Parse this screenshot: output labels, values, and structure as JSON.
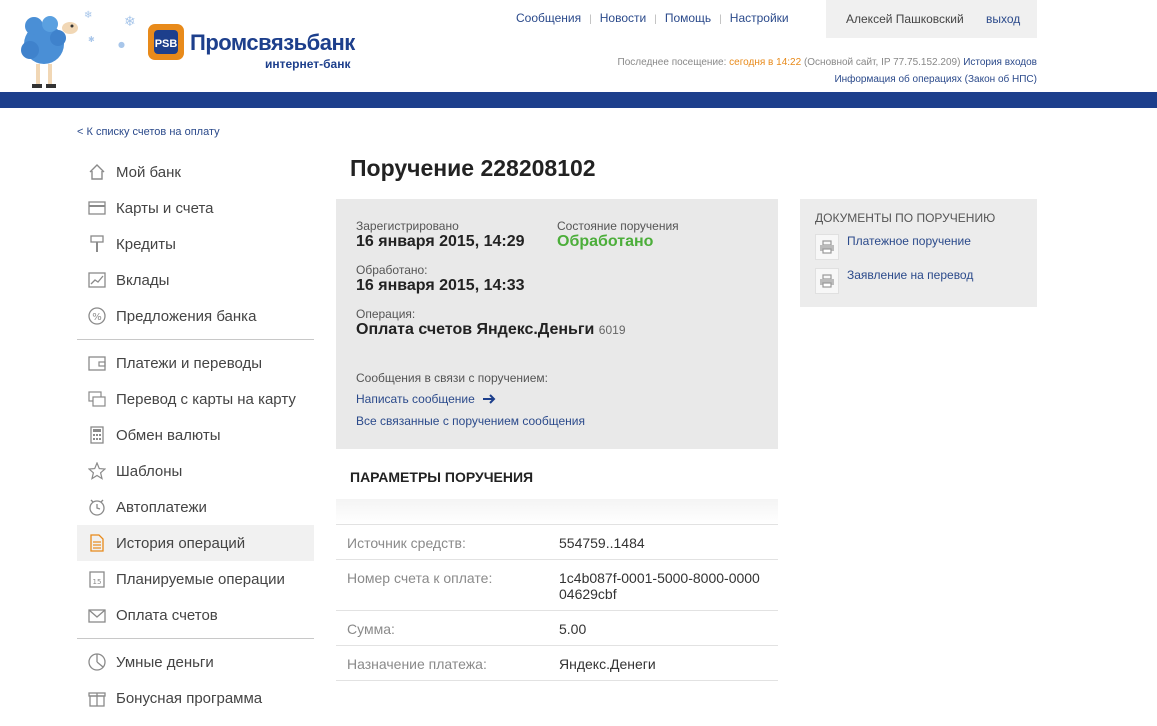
{
  "header": {
    "logo_name": "Промсвязьбанк",
    "logo_sub": "интернет-банк",
    "nav": [
      "Сообщения",
      "Новости",
      "Помощь",
      "Настройки"
    ],
    "user_name": "Алексей Пашковский",
    "logout": "выход",
    "last_visit_label": "Последнее посещение:",
    "last_visit_time": "сегодня в 14:22",
    "last_visit_details": "(Основной сайт, IP 77.75.152.209)",
    "login_history": "История входов",
    "operations_info": "Информация об операциях (Закон об НПС)"
  },
  "sidebar": {
    "back_link": "< К списку счетов на оплату",
    "groups": [
      [
        {
          "label": "Мой банк",
          "icon": "home-icon"
        },
        {
          "label": "Карты и счета",
          "icon": "card-icon"
        },
        {
          "label": "Кредиты",
          "icon": "roller-icon"
        },
        {
          "label": "Вклады",
          "icon": "chart-icon"
        },
        {
          "label": "Предложения банка",
          "icon": "percent-icon"
        }
      ],
      [
        {
          "label": "Платежи и переводы",
          "icon": "wallet-icon"
        },
        {
          "label": "Перевод с карты на карту",
          "icon": "cards-icon"
        },
        {
          "label": "Обмен валюты",
          "icon": "calculator-icon"
        },
        {
          "label": "Шаблоны",
          "icon": "star-icon"
        },
        {
          "label": "Автоплатежи",
          "icon": "clock-icon"
        },
        {
          "label": "История операций",
          "icon": "document-icon",
          "active": true
        },
        {
          "label": "Планируемые операции",
          "icon": "calendar-icon"
        },
        {
          "label": "Оплата счетов",
          "icon": "envelope-icon"
        }
      ],
      [
        {
          "label": "Умные деньги",
          "icon": "pie-icon"
        },
        {
          "label": "Бонусная программа",
          "icon": "gift-icon"
        }
      ]
    ]
  },
  "main": {
    "title": "Поручение 228208102",
    "registered_label": "Зарегистрировано",
    "registered_value": "16 января 2015, 14:29",
    "status_label": "Состояние поручения",
    "status_value": "Обработано",
    "processed_label": "Обработано:",
    "processed_value": "16 января 2015, 14:33",
    "operation_label": "Операция:",
    "operation_value": "Оплата счетов Яндекс.Деньги",
    "operation_code": "6019",
    "messages_label": "Сообщения в связи с поручением:",
    "write_message": "Написать сообщение",
    "all_messages": "Все связанные с поручением сообщения",
    "params_title": "ПАРАМЕТРЫ ПОРУЧЕНИЯ",
    "params": [
      {
        "key": "Источник средств:",
        "value": "554759..1484"
      },
      {
        "key": "Номер счета к оплате:",
        "value": "1c4b087f-0001-5000-8000-000004629cbf"
      },
      {
        "key": "Сумма:",
        "value": "5.00"
      },
      {
        "key": "Назначение платежа:",
        "value": "Яндекс.Денеги"
      }
    ]
  },
  "docs": {
    "title": "ДОКУМЕНТЫ ПО ПОРУЧЕНИЮ",
    "items": [
      "Платежное поручение",
      "Заявление на перевод"
    ]
  },
  "colors": {
    "brand_blue": "#1d3f8c",
    "accent_orange": "#e88a1a",
    "status_green": "#4cae3a"
  }
}
